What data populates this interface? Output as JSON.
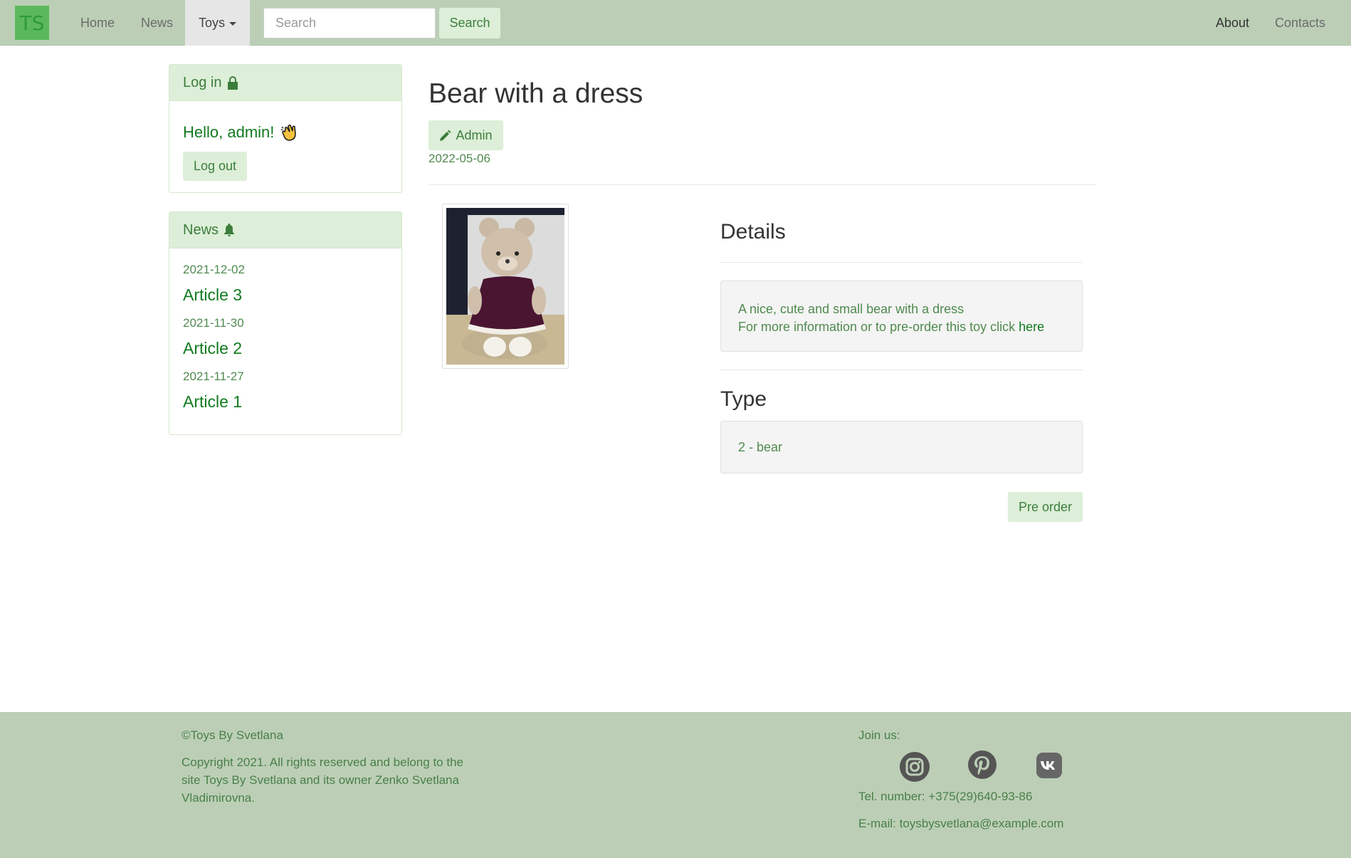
{
  "navbar": {
    "logo": "TS",
    "home": "Home",
    "news": "News",
    "toys": "Toys",
    "search_placeholder": "Search",
    "search_button": "Search",
    "about": "About",
    "contacts": "Contacts"
  },
  "login_panel": {
    "title": "Log in",
    "greeting": "Hello, admin!",
    "logout": "Log out"
  },
  "news_panel": {
    "title": "News",
    "items": [
      {
        "date": "2021-12-02",
        "title": "Article 3"
      },
      {
        "date": "2021-11-30",
        "title": "Article 2"
      },
      {
        "date": "2021-11-27",
        "title": "Article 1"
      }
    ]
  },
  "toy": {
    "title": "Bear with a dress",
    "admin_button": "Admin",
    "date": "2022-05-06",
    "details_heading": "Details",
    "description_line1": "A nice, cute and small bear with a dress",
    "description_line2": "For more information or to pre-order this toy click",
    "description_link": "here",
    "type_heading": "Type",
    "type_value": "2 - bear",
    "preorder_button": "Pre order"
  },
  "footer": {
    "copyright_title": "©Toys By Svetlana",
    "copyright_line1": "Copyright 2021. All rights reserved and belong to the",
    "copyright_line2": "site Toys By Svetlana and its owner Zenko Svetlana",
    "copyright_line3": "Vladimirovna.",
    "join_us": "Join us:",
    "tel": "Tel. number: +375(29)640-93-86",
    "email": "E-mail: toysbysvetlana@example.com",
    "social_icons": [
      "instagram-icon",
      "pinterest-icon",
      "vk-icon"
    ]
  },
  "colors": {
    "navbar_bg": "#bccfb6",
    "accent_green": "#117a1f",
    "button_bg": "#ddefd8",
    "footer_bg": "#bccfb6"
  }
}
